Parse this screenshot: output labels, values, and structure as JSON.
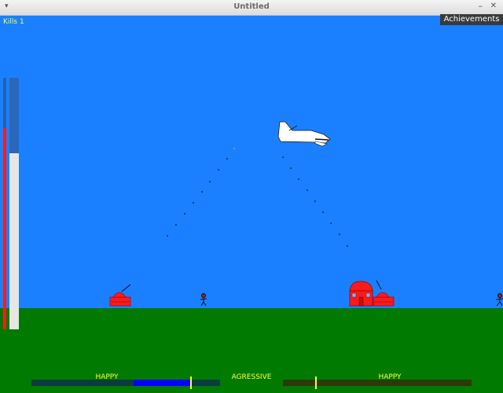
{
  "window": {
    "title": "Untitled",
    "menu_glyph": "▾",
    "min_glyph": "–",
    "close_glyph": "✕"
  },
  "hud": {
    "kills_label": "Kills 1",
    "achievements_label": "Achievements",
    "health_level": 0.8,
    "fuel_level": 0.7,
    "left_mood_label": "HAPPY",
    "center_label": "AGRESSIVE",
    "right_mood_label": "HAPPY",
    "left_meter_fill": 0.3,
    "left_meter_marker": 0.84,
    "right_meter_marker": 0.17
  },
  "colors": {
    "sky": "#1a80ff",
    "ground": "#007a00",
    "hud_text": "#ffff33",
    "enemy": "#ff1a1a",
    "health": "#ff1a1a",
    "fuel": "#e6e6e6",
    "meter_fill": "#0000ff",
    "meter_left_bg": "#0c3d3d",
    "meter_right_bg": "#2a3a0a"
  },
  "icons": {
    "player": "jet-plane-icon",
    "tank": "tank-icon",
    "house": "house-icon",
    "soldier": "soldier-icon"
  }
}
